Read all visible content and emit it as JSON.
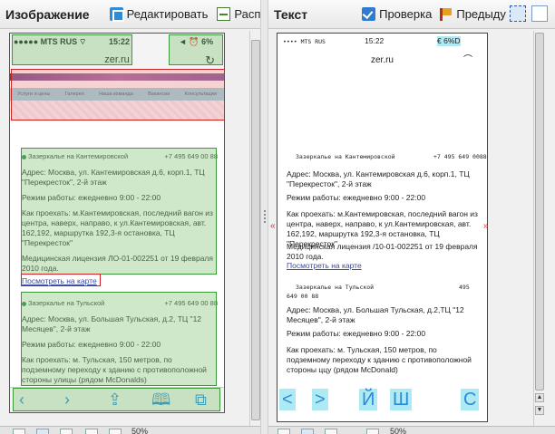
{
  "left_toolbar": {
    "title": "Изображение",
    "edit_label": "Редактировать",
    "recognize_label": "Расп"
  },
  "right_toolbar": {
    "title": "Текст",
    "verify_label": "Проверка",
    "prev_label": "Предыду"
  },
  "image_view": {
    "status_left": "●●●●● MTS RUS",
    "wifi": "⌔",
    "time": "15:22",
    "status_right": "◄ ⏰ 6%",
    "url": "zer.ru",
    "reload_icon": "↻",
    "nav_items": [
      "Услуги и цены",
      "Галерея",
      "Наша команда",
      "Вакансии",
      "Консультации"
    ],
    "clinic1": {
      "name": "Зазеркалье на Кантемировской",
      "phone": "+7 495 649 00 88",
      "address": "Адрес: Москва, ул. Кантемировская д.6, корп.1, ТЦ \"Перекресток\", 2-й этаж",
      "hours": "Режим работы: ежедневно 9:00 - 22:00",
      "directions": "Как проехать: м.Кантемировская, последний вагон из центра, наверх, направо, к ул.Кантемировская, авт. 162,192, маршрутка 192,3-я остановка, ТЦ \"Перекресток\"",
      "license": "Медицинская лицензия ЛО-01-002251 от 19 февраля 2010 года.",
      "map_link": "Посмотреть на карте"
    },
    "clinic2": {
      "name": "Зазеркалье на Тульской",
      "phone": "+7 495 649 00 88",
      "address": "Адрес: Москва, ул. Большая Тульская, д.2, ТЦ \"12 Месяцев\", 2-й этаж",
      "hours": "Режим работы: ежедневно 9:00 - 22:00",
      "directions": "Как проехать: м. Тульская, 150 метров, по подземному переходу к зданию с противоположной стороны улицы (рядом McDonalds)"
    },
    "toolbar_icons": {
      "back": "‹",
      "forward": "›",
      "share": "⇪",
      "book": "🕮",
      "tabs": "⧉"
    }
  },
  "text_view": {
    "status_left": "•••• MTS RUS",
    "time": "15:22",
    "status_right": "€ 6%D",
    "url": "zer.ru",
    "clinic1_header": "Зазеркалье на Кантемировской",
    "clinic1_phone": "+7 495 649 0088",
    "clinic1_address": "Адрес: Москва, ул. Кантемировская д.6, корп.1, ТЦ \"Перекресток\", 2-й этаж",
    "clinic1_hours": "Режим работы: ежедневно 9:00 - 22:00",
    "clinic1_directions": "Как проехать: м.Кантемировская, последний вагон из центра, наверх, направо, к ул.Кантемировская, авт. 162,192, маршрутка 192,3-я остановка, ТЦ \"Перекресток\"",
    "clinic1_license": "Медицинская лицензия /10-01-002251 от 19 февраля 2010 года.",
    "map_link": "Посмотреть на карте",
    "clinic2_header": "Зазеркалье на Тульской",
    "clinic2_phone_a": "495",
    "clinic2_phone_b": "649 00 88",
    "clinic2_address": "Адрес: Москва, ул. Большая Тульская, д.2,ТЦ \"12 Месяцев\", 2-й этаж",
    "clinic2_hours": "Режим работы: ежедневно 9:00 - 22:00",
    "clinic2_directions": "Как проехать: м. Тульская, 150 метров, по подземному переходу к зданию с противоположной стороны ццу (рядом McDonald)",
    "nav": [
      "<",
      ">",
      "Й",
      "Ш",
      "С"
    ]
  },
  "zoom": {
    "left": "50%",
    "right": "50%"
  }
}
